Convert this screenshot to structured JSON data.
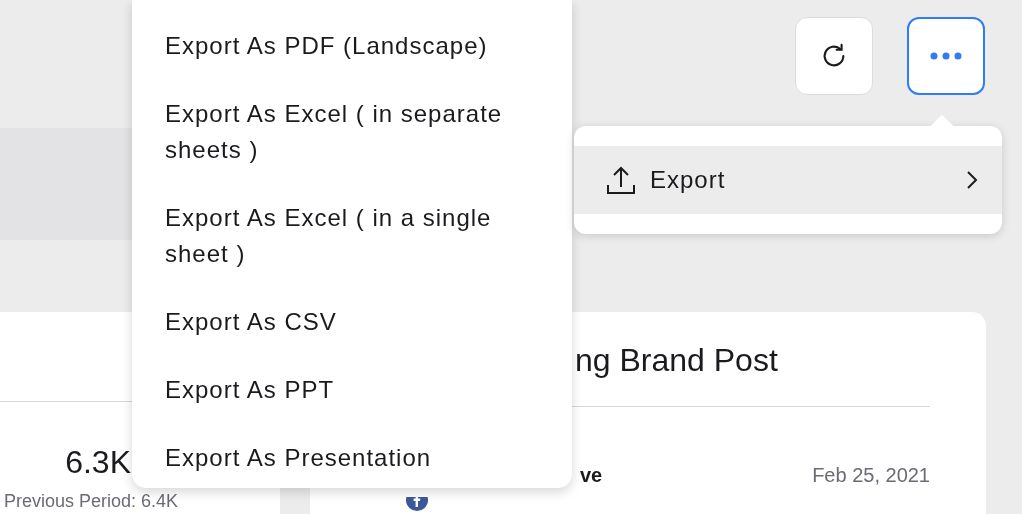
{
  "toolbar": {
    "menu_open": true
  },
  "more_menu": {
    "items": [
      {
        "label": "Export",
        "highlighted": true
      }
    ]
  },
  "export_submenu": {
    "items": [
      {
        "label": "Export As PDF (Landscape)"
      },
      {
        "label": "Export As Excel ( in separate sheets )"
      },
      {
        "label": "Export As Excel ( in a single sheet )"
      },
      {
        "label": "Export As CSV"
      },
      {
        "label": "Export As PPT"
      },
      {
        "label": "Export As Presentation"
      }
    ]
  },
  "metric_card": {
    "value": "6.3K",
    "previous": "Previous Period: 6.4K"
  },
  "post_card": {
    "title": "ng Brand Post",
    "author": "ve",
    "date": "Feb 25, 2021"
  }
}
